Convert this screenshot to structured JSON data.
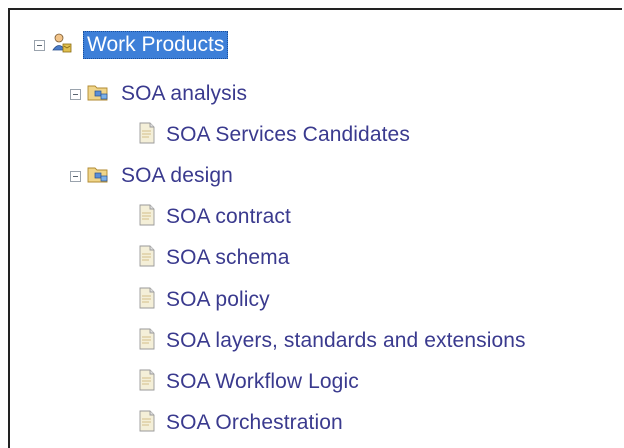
{
  "tree": {
    "root": {
      "label": "Work Products",
      "icon": "work-products-icon",
      "expanded": true,
      "selected": true
    },
    "groups": [
      {
        "label": "SOA analysis",
        "icon": "folder-group-icon",
        "expanded": true,
        "items": [
          {
            "label": "SOA Services Candidates",
            "icon": "document-icon"
          }
        ]
      },
      {
        "label": "SOA design",
        "icon": "folder-group-icon",
        "expanded": true,
        "items": [
          {
            "label": "SOA contract",
            "icon": "document-icon"
          },
          {
            "label": "SOA schema",
            "icon": "document-icon"
          },
          {
            "label": "SOA policy",
            "icon": "document-icon"
          },
          {
            "label": "SOA layers, standards and extensions",
            "icon": "document-icon"
          },
          {
            "label": "SOA Workflow Logic",
            "icon": "document-icon"
          },
          {
            "label": "SOA Orchestration",
            "icon": "document-icon"
          }
        ]
      }
    ]
  },
  "colors": {
    "selection": "#3d7fd8",
    "text": "#3a3a8e"
  }
}
